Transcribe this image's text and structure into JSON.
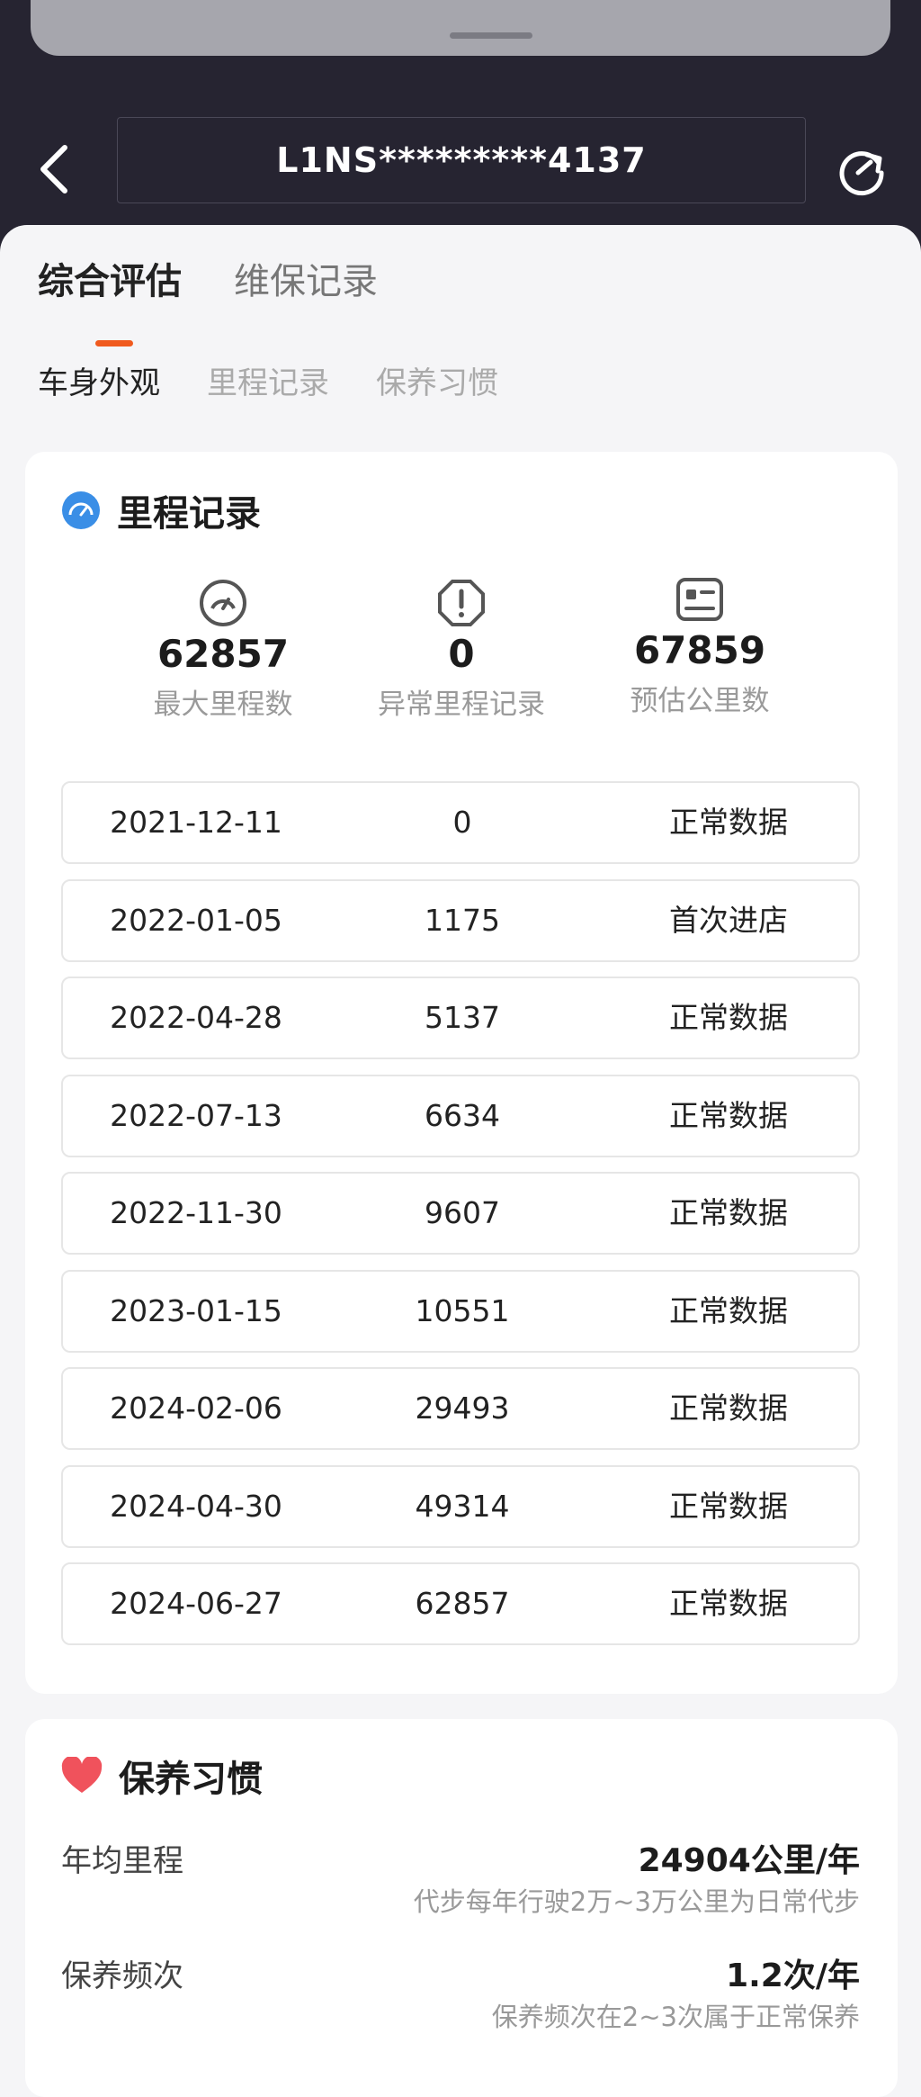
{
  "header": {
    "vin": "L1NS*********4137"
  },
  "main_tabs": [
    {
      "label": "综合评估",
      "active": true
    },
    {
      "label": "维保记录",
      "active": false
    }
  ],
  "sub_tabs": [
    {
      "label": "车身外观",
      "active": true
    },
    {
      "label": "里程记录",
      "active": false
    },
    {
      "label": "保养习惯",
      "active": false
    }
  ],
  "mileage": {
    "title": "里程记录",
    "stats": [
      {
        "value": "62857",
        "label": "最大里程数",
        "icon": "gauge-icon"
      },
      {
        "value": "0",
        "label": "异常里程记录",
        "icon": "warning-octagon-icon"
      },
      {
        "value": "67859",
        "label": "预估公里数",
        "icon": "id-card-icon"
      }
    ],
    "records": [
      {
        "date": "2021-12-11",
        "km": "0",
        "status": "正常数据"
      },
      {
        "date": "2022-01-05",
        "km": "1175",
        "status": "首次进店"
      },
      {
        "date": "2022-04-28",
        "km": "5137",
        "status": "正常数据"
      },
      {
        "date": "2022-07-13",
        "km": "6634",
        "status": "正常数据"
      },
      {
        "date": "2022-11-30",
        "km": "9607",
        "status": "正常数据"
      },
      {
        "date": "2023-01-15",
        "km": "10551",
        "status": "正常数据"
      },
      {
        "date": "2024-02-06",
        "km": "29493",
        "status": "正常数据"
      },
      {
        "date": "2024-04-30",
        "km": "49314",
        "status": "正常数据"
      },
      {
        "date": "2024-06-27",
        "km": "62857",
        "status": "正常数据"
      }
    ]
  },
  "habits": {
    "title": "保养习惯",
    "annual_label": "年均里程",
    "annual_value": "24904公里/年",
    "annual_hint": "代步每年行驶2万~3万公里为日常代步",
    "freq_label": "保养频次",
    "freq_value": "1.2次/年",
    "freq_hint": "保养频次在2~3次属于正常保养"
  },
  "colors": {
    "accent": "#f05a1e",
    "header_bg": "#262431",
    "heart": "#f0525c",
    "speed_icon": "#3a8ee6"
  }
}
